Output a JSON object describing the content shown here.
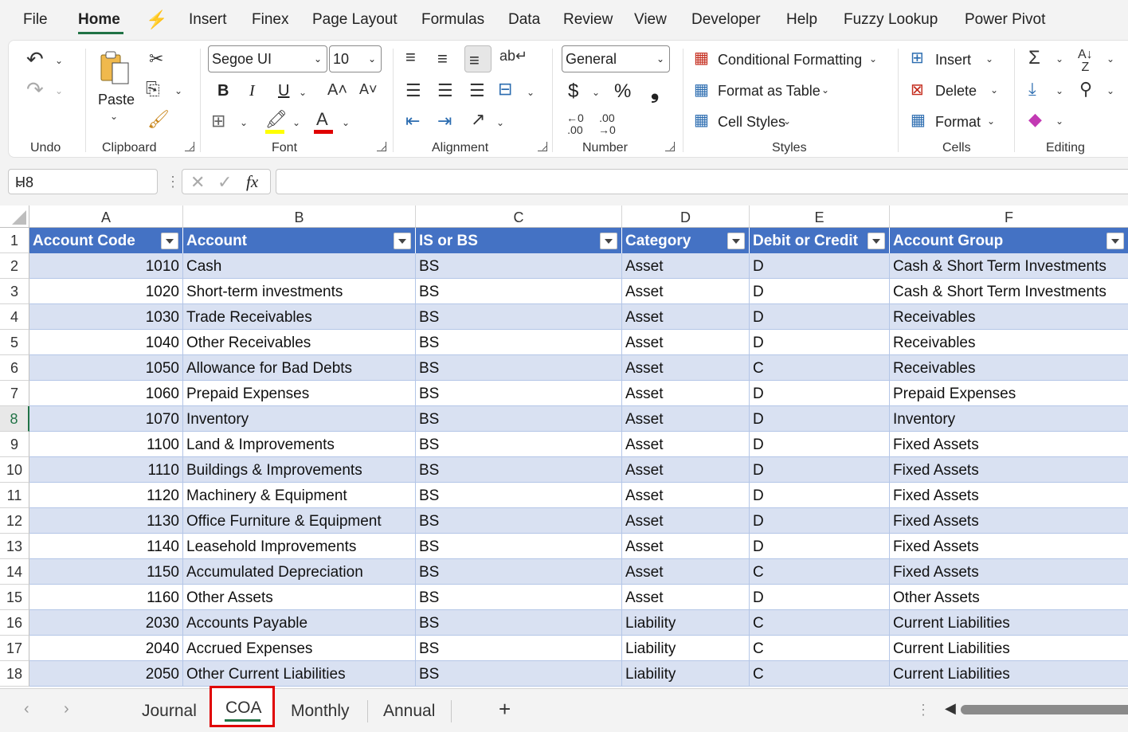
{
  "menu": {
    "file": "File",
    "home": "Home",
    "insert": "Insert",
    "finex": "Finex",
    "page_layout": "Page Layout",
    "formulas": "Formulas",
    "data": "Data",
    "review": "Review",
    "view": "View",
    "developer": "Developer",
    "help": "Help",
    "fuzzy_lookup": "Fuzzy Lookup",
    "power_pivot": "Power Pivot"
  },
  "ribbon": {
    "undo_group": "Undo",
    "clipboard_group": "Clipboard",
    "paste": "Paste",
    "font_group": "Font",
    "font_name": "Segoe UI",
    "font_size": "10",
    "bold": "B",
    "italic": "I",
    "underline": "U",
    "alignment_group": "Alignment",
    "number_group": "Number",
    "number_format": "General",
    "currency": "$",
    "percent": "%",
    "comma": "❟",
    "styles_group": "Styles",
    "conditional_formatting": "Conditional Formatting",
    "format_as_table": "Format as Table",
    "cell_styles": "Cell Styles",
    "cells_group": "Cells",
    "insert": "Insert",
    "delete": "Delete",
    "format": "Format",
    "editing_group": "Editing"
  },
  "formula_bar": {
    "name_box": "H8",
    "fx": "fx",
    "content": ""
  },
  "columns": [
    "A",
    "B",
    "C",
    "D",
    "E",
    "F"
  ],
  "table": {
    "headers": [
      "Account Code",
      "Account",
      "IS or BS",
      "Category",
      "Debit or Credit",
      "Account Group"
    ],
    "rows": [
      [
        "1010",
        "Cash",
        "BS",
        "Asset",
        "D",
        "Cash & Short Term Investments"
      ],
      [
        "1020",
        "Short-term investments",
        "BS",
        "Asset",
        "D",
        "Cash & Short Term Investments"
      ],
      [
        "1030",
        "Trade Receivables",
        "BS",
        "Asset",
        "D",
        "Receivables"
      ],
      [
        "1040",
        "Other Receivables",
        "BS",
        "Asset",
        "D",
        "Receivables"
      ],
      [
        "1050",
        "Allowance for Bad Debts",
        "BS",
        "Asset",
        "C",
        "Receivables"
      ],
      [
        "1060",
        "Prepaid Expenses",
        "BS",
        "Asset",
        "D",
        "Prepaid Expenses"
      ],
      [
        "1070",
        "Inventory",
        "BS",
        "Asset",
        "D",
        "Inventory"
      ],
      [
        "1100",
        "Land & Improvements",
        "BS",
        "Asset",
        "D",
        "Fixed Assets"
      ],
      [
        "1110",
        "Buildings & Improvements",
        "BS",
        "Asset",
        "D",
        "Fixed Assets"
      ],
      [
        "1120",
        "Machinery & Equipment",
        "BS",
        "Asset",
        "D",
        "Fixed Assets"
      ],
      [
        "1130",
        "Office Furniture & Equipment",
        "BS",
        "Asset",
        "D",
        "Fixed Assets"
      ],
      [
        "1140",
        "Leasehold Improvements",
        "BS",
        "Asset",
        "D",
        "Fixed Assets"
      ],
      [
        "1150",
        "Accumulated Depreciation",
        "BS",
        "Asset",
        "C",
        "Fixed Assets"
      ],
      [
        "1160",
        "Other Assets",
        "BS",
        "Asset",
        "D",
        "Other Assets"
      ],
      [
        "2030",
        "Accounts Payable",
        "BS",
        "Liability",
        "C",
        "Current Liabilities"
      ],
      [
        "2040",
        "Accrued Expenses",
        "BS",
        "Liability",
        "C",
        "Current Liabilities"
      ],
      [
        "2050",
        "Other Current Liabilities",
        "BS",
        "Liability",
        "C",
        "Current Liabilities"
      ]
    ]
  },
  "row_numbers": [
    "1",
    "2",
    "3",
    "4",
    "5",
    "6",
    "7",
    "8",
    "9",
    "10",
    "11",
    "12",
    "13",
    "14",
    "15",
    "16",
    "17",
    "18"
  ],
  "selected_row": "8",
  "sheets": {
    "tabs": [
      "Journal",
      "COA",
      "Monthly",
      "Annual"
    ],
    "active": "COA",
    "add": "+"
  },
  "colors": {
    "accent": "#217346",
    "table_header": "#4472c4",
    "band": "#d9e1f2",
    "highlight": "#e00000"
  }
}
